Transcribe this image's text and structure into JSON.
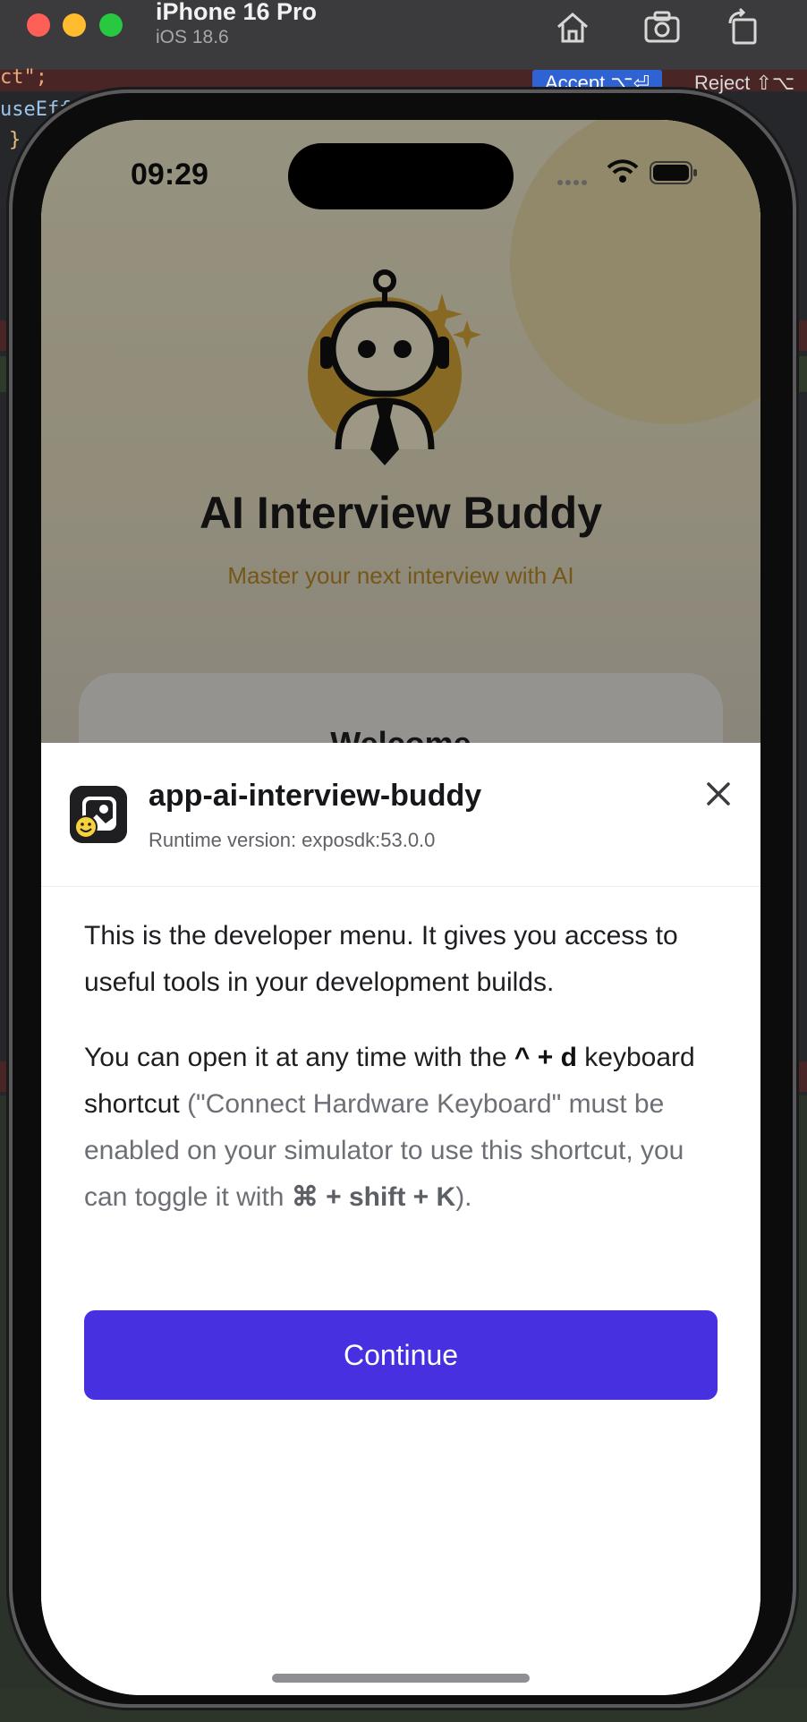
{
  "simulator": {
    "device_name": "iPhone 16 Pro",
    "os_version": "iOS 18.6",
    "icons": [
      "home-icon",
      "screenshot-icon",
      "rotate-icon"
    ]
  },
  "editor": {
    "accept_label": "Accept ⌥⏎",
    "reject_label": "Reject ⇧⌥",
    "snippets": [
      "ct\";",
      "useEffe",
      "} f"
    ]
  },
  "status_bar": {
    "time": "09:29"
  },
  "app": {
    "title": "AI Interview Buddy",
    "subtitle": "Master your next interview with AI",
    "welcome": "Welcome",
    "colors": {
      "accent": "#b8882a",
      "mascot_gold": "#d4a537"
    }
  },
  "dev_menu": {
    "app_name": "app-ai-interview-buddy",
    "runtime": "Runtime version: exposdk:53.0.0",
    "intro": "This is the developer menu. It gives you access to useful tools in your development builds.",
    "open_prefix": "You can open it at any time with the",
    "shortcut": "^ + d",
    "shortcut_suffix": "keyboard shortcut",
    "note_before": "(\"Connect Hardware Keyboard\" must be enabled on your simulator to use this shortcut, you can toggle it with",
    "toggle_shortcut": "⌘ + shift + K",
    "note_after": ").",
    "continue_label": "Continue",
    "colors": {
      "primary": "#4630e0"
    }
  }
}
